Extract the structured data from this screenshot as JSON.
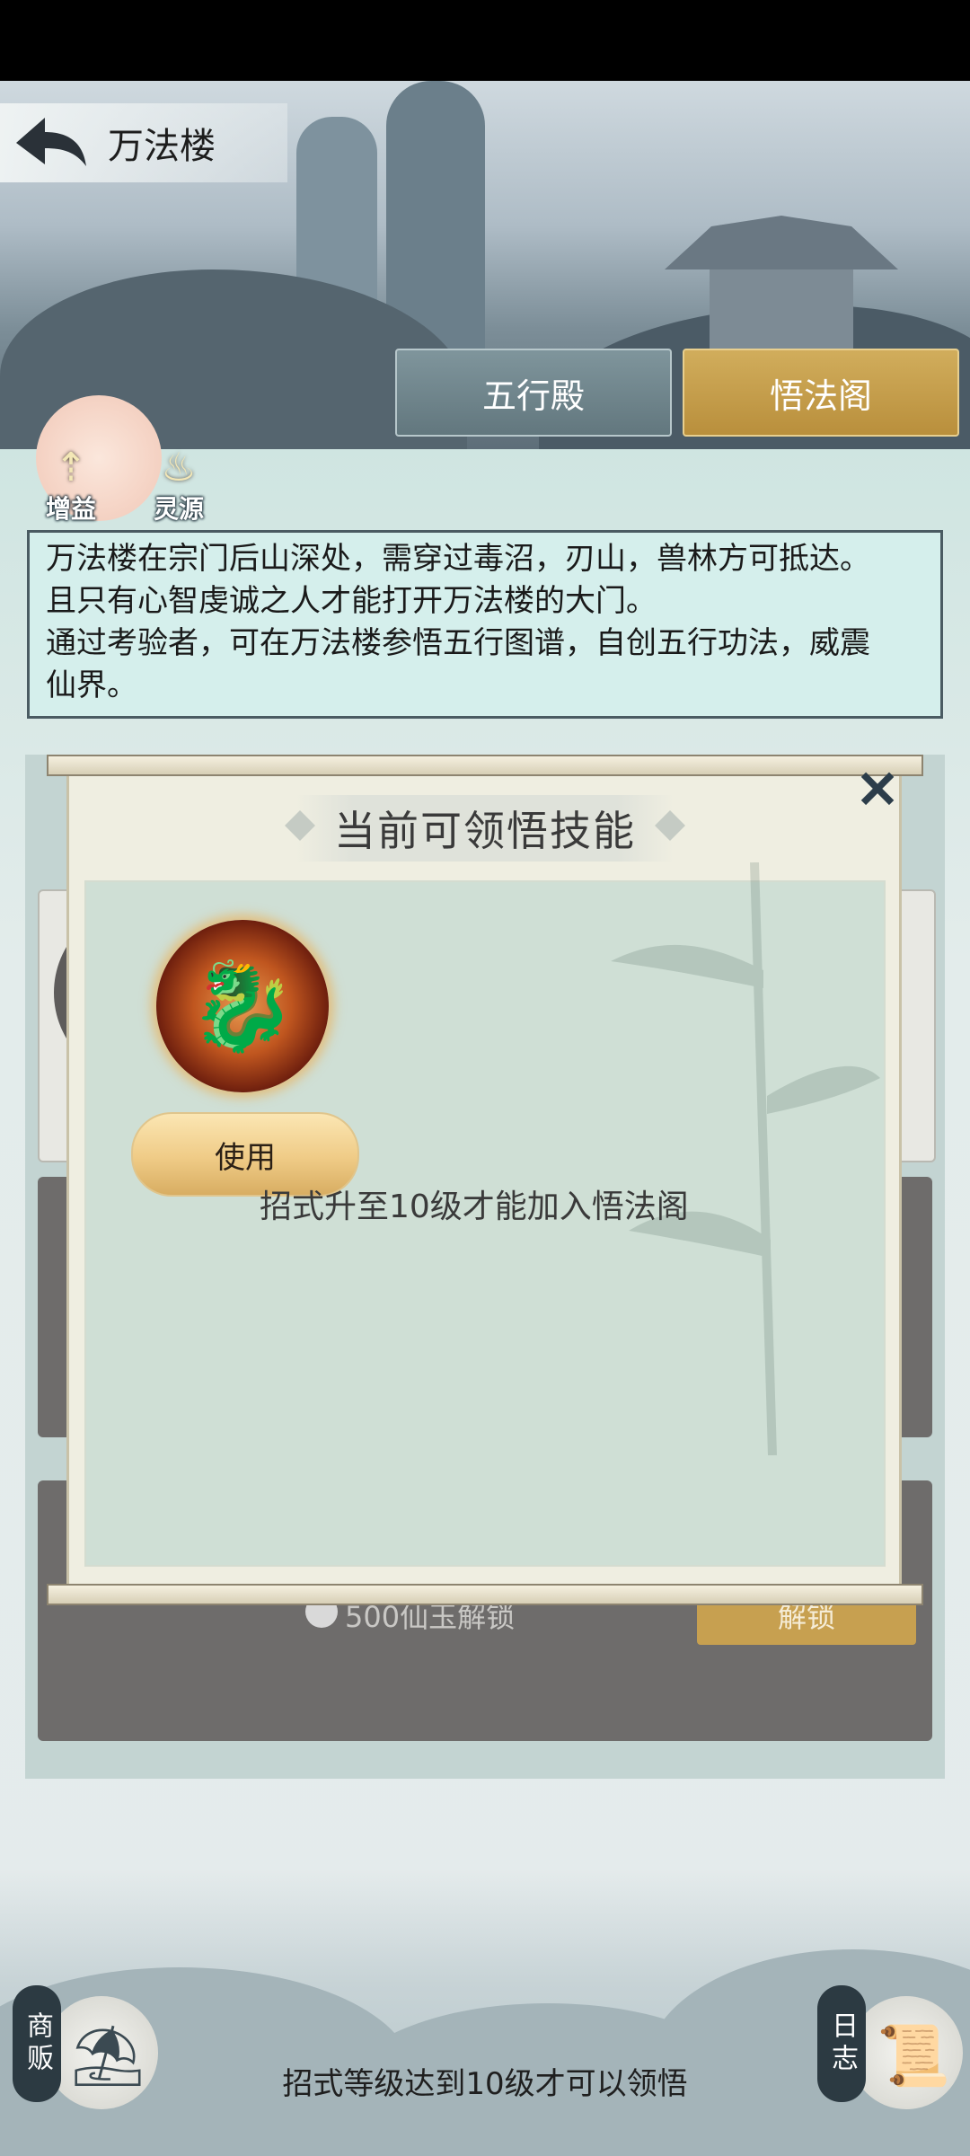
{
  "header": {
    "title": "万法楼"
  },
  "tabs": [
    {
      "label": "五行殿",
      "active": false
    },
    {
      "label": "悟法阁",
      "active": true
    }
  ],
  "side_icons": [
    {
      "label": "增益",
      "icon": "arrow-up-icon"
    },
    {
      "label": "灵源",
      "icon": "flame-icon"
    }
  ],
  "description": {
    "lines": [
      "万法楼在宗门后山深处，需穿过毒沼，刃山，兽林方可抵达。",
      "且只有心智虔诚之人才能打开万法楼的大门。",
      "通过考验者，可在万法楼参悟五行图谱，自创五行功法，威震",
      "仙界。"
    ]
  },
  "background_list": {
    "unlock_cost_text": "500仙玉解锁",
    "unlock_button": "解锁"
  },
  "modal": {
    "title": "当前可领悟技能",
    "close_icon": "close-icon",
    "skill_icon": "fire-beast-icon",
    "use_button": "使用",
    "hint": "招式升至10级才能加入悟法阁"
  },
  "bottom": {
    "left_button": {
      "label": "商贩",
      "icon": "merchant-icon"
    },
    "right_button": {
      "label": "日志",
      "icon": "scroll-icon"
    },
    "message": "招式等级达到10级才可以领悟"
  },
  "colors": {
    "active_tab": "#c9a24f",
    "inactive_tab": "#6f858c",
    "description_bg": "#d5efec",
    "modal_bg": "#efeee1",
    "modal_inner_bg": "#cfdfd5",
    "use_button": "#efcb86"
  }
}
